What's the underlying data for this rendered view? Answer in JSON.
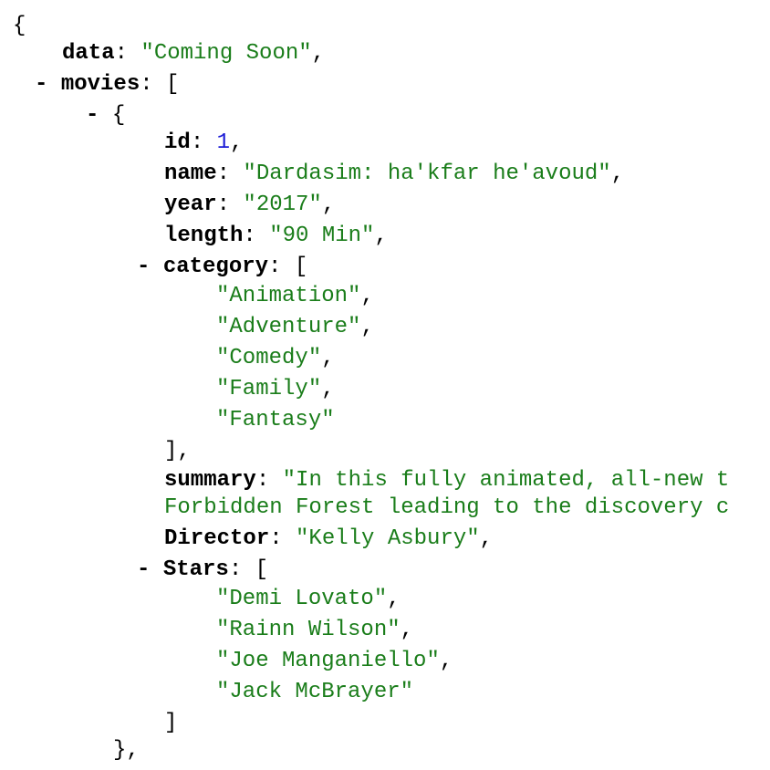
{
  "colors": {
    "string": "#1a7d1a",
    "number": "#1a1ad6",
    "key": "#000000",
    "background": "#ffffff"
  },
  "toggle_glyph": "-",
  "brace_open": "{",
  "bracket_open": "[",
  "keys": {
    "data": "data",
    "movies": "movies",
    "id": "id",
    "name": "name",
    "year": "year",
    "length": "length",
    "category": "category",
    "summary": "summary",
    "director": "Director",
    "stars": "Stars"
  },
  "values": {
    "data": "\"Coming Soon\"",
    "id": "1",
    "name": "\"Dardasim: ha'kfar he'avoud\"",
    "year": "\"2017\"",
    "length": "\"90 Min\"",
    "summary_line1": "\"In this fully animated, all-new t",
    "summary_line2": "Forbidden Forest leading to the discovery c",
    "director": "\"Kelly Asbury\""
  },
  "category": [
    "\"Animation\"",
    "\"Adventure\"",
    "\"Comedy\"",
    "\"Family\"",
    "\"Fantasy\""
  ],
  "stars": [
    "\"Demi Lovato\"",
    "\"Rainn Wilson\"",
    "\"Joe Manganiello\"",
    "\"Jack McBrayer\""
  ]
}
